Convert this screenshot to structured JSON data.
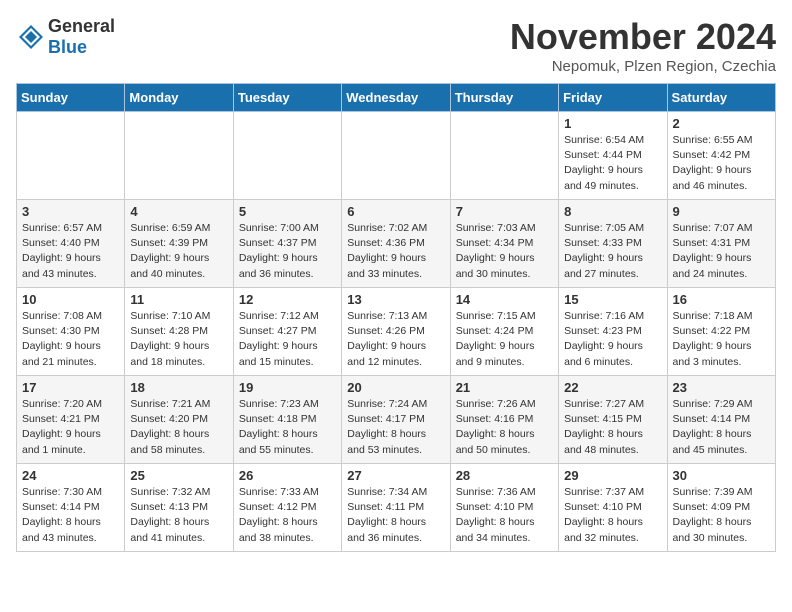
{
  "logo": {
    "text_general": "General",
    "text_blue": "Blue"
  },
  "header": {
    "month_title": "November 2024",
    "subtitle": "Nepomuk, Plzen Region, Czechia"
  },
  "days_of_week": [
    "Sunday",
    "Monday",
    "Tuesday",
    "Wednesday",
    "Thursday",
    "Friday",
    "Saturday"
  ],
  "weeks": [
    [
      {
        "day": "",
        "info": ""
      },
      {
        "day": "",
        "info": ""
      },
      {
        "day": "",
        "info": ""
      },
      {
        "day": "",
        "info": ""
      },
      {
        "day": "",
        "info": ""
      },
      {
        "day": "1",
        "info": "Sunrise: 6:54 AM\nSunset: 4:44 PM\nDaylight: 9 hours\nand 49 minutes."
      },
      {
        "day": "2",
        "info": "Sunrise: 6:55 AM\nSunset: 4:42 PM\nDaylight: 9 hours\nand 46 minutes."
      }
    ],
    [
      {
        "day": "3",
        "info": "Sunrise: 6:57 AM\nSunset: 4:40 PM\nDaylight: 9 hours\nand 43 minutes."
      },
      {
        "day": "4",
        "info": "Sunrise: 6:59 AM\nSunset: 4:39 PM\nDaylight: 9 hours\nand 40 minutes."
      },
      {
        "day": "5",
        "info": "Sunrise: 7:00 AM\nSunset: 4:37 PM\nDaylight: 9 hours\nand 36 minutes."
      },
      {
        "day": "6",
        "info": "Sunrise: 7:02 AM\nSunset: 4:36 PM\nDaylight: 9 hours\nand 33 minutes."
      },
      {
        "day": "7",
        "info": "Sunrise: 7:03 AM\nSunset: 4:34 PM\nDaylight: 9 hours\nand 30 minutes."
      },
      {
        "day": "8",
        "info": "Sunrise: 7:05 AM\nSunset: 4:33 PM\nDaylight: 9 hours\nand 27 minutes."
      },
      {
        "day": "9",
        "info": "Sunrise: 7:07 AM\nSunset: 4:31 PM\nDaylight: 9 hours\nand 24 minutes."
      }
    ],
    [
      {
        "day": "10",
        "info": "Sunrise: 7:08 AM\nSunset: 4:30 PM\nDaylight: 9 hours\nand 21 minutes."
      },
      {
        "day": "11",
        "info": "Sunrise: 7:10 AM\nSunset: 4:28 PM\nDaylight: 9 hours\nand 18 minutes."
      },
      {
        "day": "12",
        "info": "Sunrise: 7:12 AM\nSunset: 4:27 PM\nDaylight: 9 hours\nand 15 minutes."
      },
      {
        "day": "13",
        "info": "Sunrise: 7:13 AM\nSunset: 4:26 PM\nDaylight: 9 hours\nand 12 minutes."
      },
      {
        "day": "14",
        "info": "Sunrise: 7:15 AM\nSunset: 4:24 PM\nDaylight: 9 hours\nand 9 minutes."
      },
      {
        "day": "15",
        "info": "Sunrise: 7:16 AM\nSunset: 4:23 PM\nDaylight: 9 hours\nand 6 minutes."
      },
      {
        "day": "16",
        "info": "Sunrise: 7:18 AM\nSunset: 4:22 PM\nDaylight: 9 hours\nand 3 minutes."
      }
    ],
    [
      {
        "day": "17",
        "info": "Sunrise: 7:20 AM\nSunset: 4:21 PM\nDaylight: 9 hours\nand 1 minute."
      },
      {
        "day": "18",
        "info": "Sunrise: 7:21 AM\nSunset: 4:20 PM\nDaylight: 8 hours\nand 58 minutes."
      },
      {
        "day": "19",
        "info": "Sunrise: 7:23 AM\nSunset: 4:18 PM\nDaylight: 8 hours\nand 55 minutes."
      },
      {
        "day": "20",
        "info": "Sunrise: 7:24 AM\nSunset: 4:17 PM\nDaylight: 8 hours\nand 53 minutes."
      },
      {
        "day": "21",
        "info": "Sunrise: 7:26 AM\nSunset: 4:16 PM\nDaylight: 8 hours\nand 50 minutes."
      },
      {
        "day": "22",
        "info": "Sunrise: 7:27 AM\nSunset: 4:15 PM\nDaylight: 8 hours\nand 48 minutes."
      },
      {
        "day": "23",
        "info": "Sunrise: 7:29 AM\nSunset: 4:14 PM\nDaylight: 8 hours\nand 45 minutes."
      }
    ],
    [
      {
        "day": "24",
        "info": "Sunrise: 7:30 AM\nSunset: 4:14 PM\nDaylight: 8 hours\nand 43 minutes."
      },
      {
        "day": "25",
        "info": "Sunrise: 7:32 AM\nSunset: 4:13 PM\nDaylight: 8 hours\nand 41 minutes."
      },
      {
        "day": "26",
        "info": "Sunrise: 7:33 AM\nSunset: 4:12 PM\nDaylight: 8 hours\nand 38 minutes."
      },
      {
        "day": "27",
        "info": "Sunrise: 7:34 AM\nSunset: 4:11 PM\nDaylight: 8 hours\nand 36 minutes."
      },
      {
        "day": "28",
        "info": "Sunrise: 7:36 AM\nSunset: 4:10 PM\nDaylight: 8 hours\nand 34 minutes."
      },
      {
        "day": "29",
        "info": "Sunrise: 7:37 AM\nSunset: 4:10 PM\nDaylight: 8 hours\nand 32 minutes."
      },
      {
        "day": "30",
        "info": "Sunrise: 7:39 AM\nSunset: 4:09 PM\nDaylight: 8 hours\nand 30 minutes."
      }
    ]
  ]
}
